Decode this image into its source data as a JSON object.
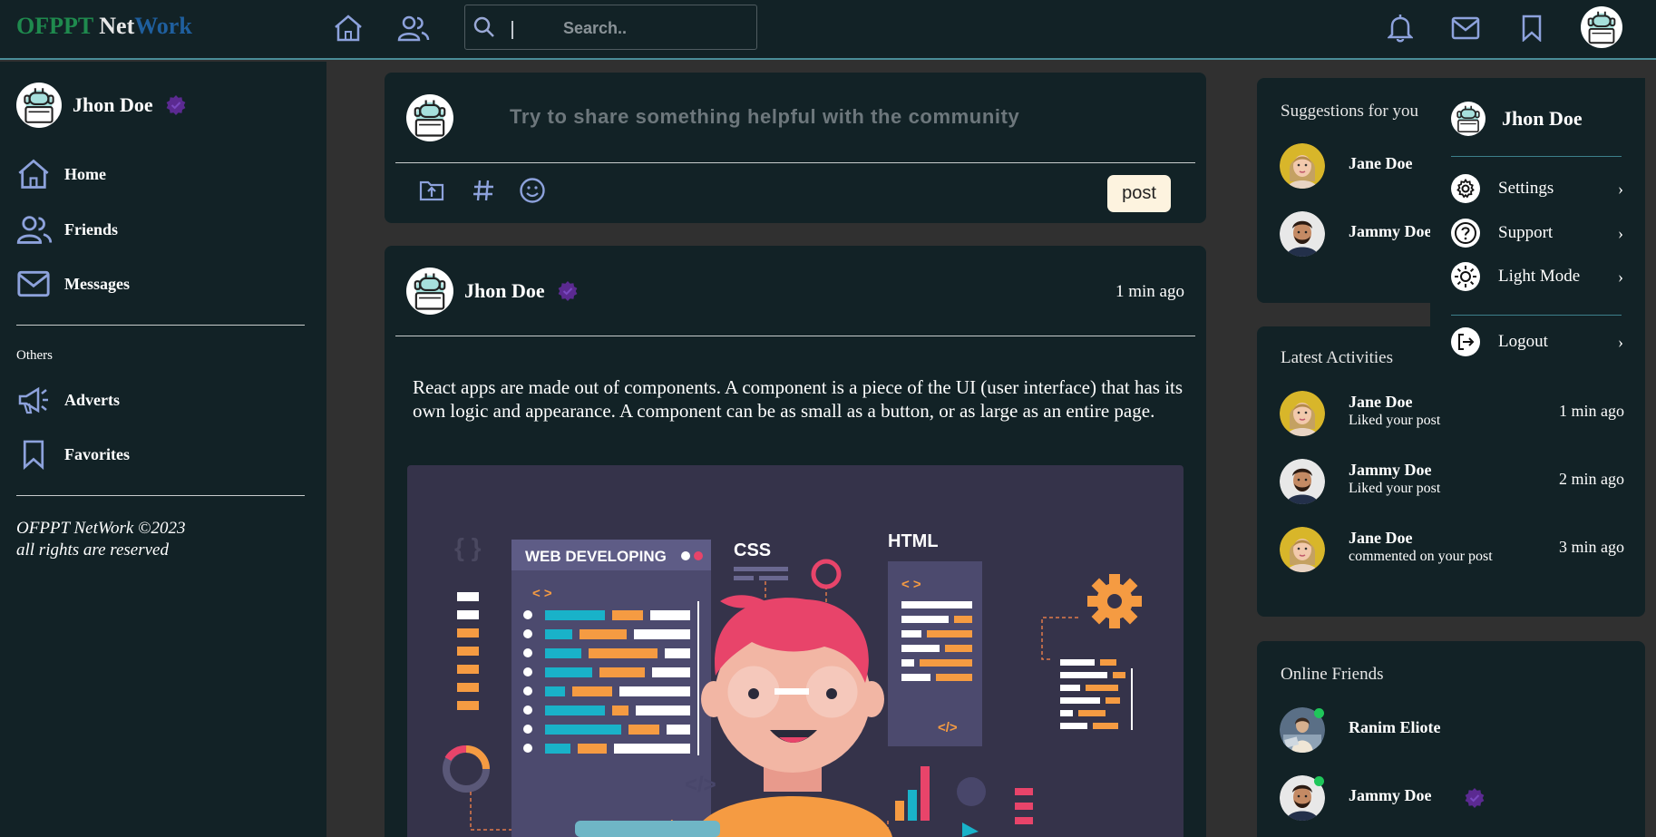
{
  "brand": {
    "part1": "OFPPT",
    "part2": "Net",
    "part3": "Work"
  },
  "topbar": {
    "search_placeholder": "Search..",
    "icons": [
      "home-icon",
      "friends-icon",
      "search-icon",
      "bell-icon",
      "mail-icon",
      "bookmark-icon",
      "avatar"
    ]
  },
  "colors": {
    "background": "#303030",
    "panel": "#122226",
    "accent_line": "#4a8d98",
    "verified": "#5b2a91",
    "online_dot": "#1fc65a",
    "post_button": "#fdf3df"
  },
  "sidebar": {
    "user_name": "Jhon Doe",
    "nav": [
      {
        "label": "Home",
        "icon": "home-icon"
      },
      {
        "label": "Friends",
        "icon": "friends-icon"
      },
      {
        "label": "Messages",
        "icon": "mail-icon"
      }
    ],
    "others_label": "Others",
    "others": [
      {
        "label": "Adverts",
        "icon": "megaphone-icon"
      },
      {
        "label": "Favorites",
        "icon": "bookmark-icon"
      }
    ],
    "copyright_line1": "OFPPT NetWork ©2023",
    "copyright_line2": "all rights are reserved"
  },
  "composer": {
    "placeholder": "Try to share something helpful with the community",
    "tools": [
      "upload-folder-icon",
      "hashtag-icon",
      "emoji-icon"
    ],
    "post_label": "post"
  },
  "post": {
    "author": "Jhon Doe",
    "time": "1 min ago",
    "text": "React apps are made out of components. A component is a piece of the UI (user interface) that has its own logic and appearance. A component can be as small as a button, or as large as an entire page.",
    "image": {
      "panel_title": "WEB DEVELOPING",
      "css_label": "CSS",
      "html_label": "HTML",
      "tag_open": "< >",
      "tag_close": "</>"
    }
  },
  "suggestions": {
    "title": "Suggestions for you",
    "people": [
      {
        "name": "Jane Doe"
      },
      {
        "name": "Jammy Doe"
      }
    ]
  },
  "activities": {
    "title": "Latest Activities",
    "items": [
      {
        "name": "Jane Doe",
        "action": "Liked your post",
        "time": "1 min ago"
      },
      {
        "name": "Jammy Doe",
        "action": "Liked your post",
        "time": "2 min ago"
      },
      {
        "name": "Jane Doe",
        "action": "commented on your post",
        "time": "3 min ago"
      }
    ]
  },
  "online": {
    "title": "Online Friends",
    "friends": [
      {
        "name": "Ranim Eliote"
      },
      {
        "name": "Jammy Doe"
      }
    ]
  },
  "dropdown": {
    "user_name": "Jhon Doe",
    "items": [
      {
        "label": "Settings",
        "icon": "gear-icon"
      },
      {
        "label": "Support",
        "icon": "help-icon"
      },
      {
        "label": "Light Mode",
        "icon": "sun-icon"
      },
      {
        "label": "Logout",
        "icon": "logout-icon"
      }
    ],
    "chevron": "›"
  }
}
